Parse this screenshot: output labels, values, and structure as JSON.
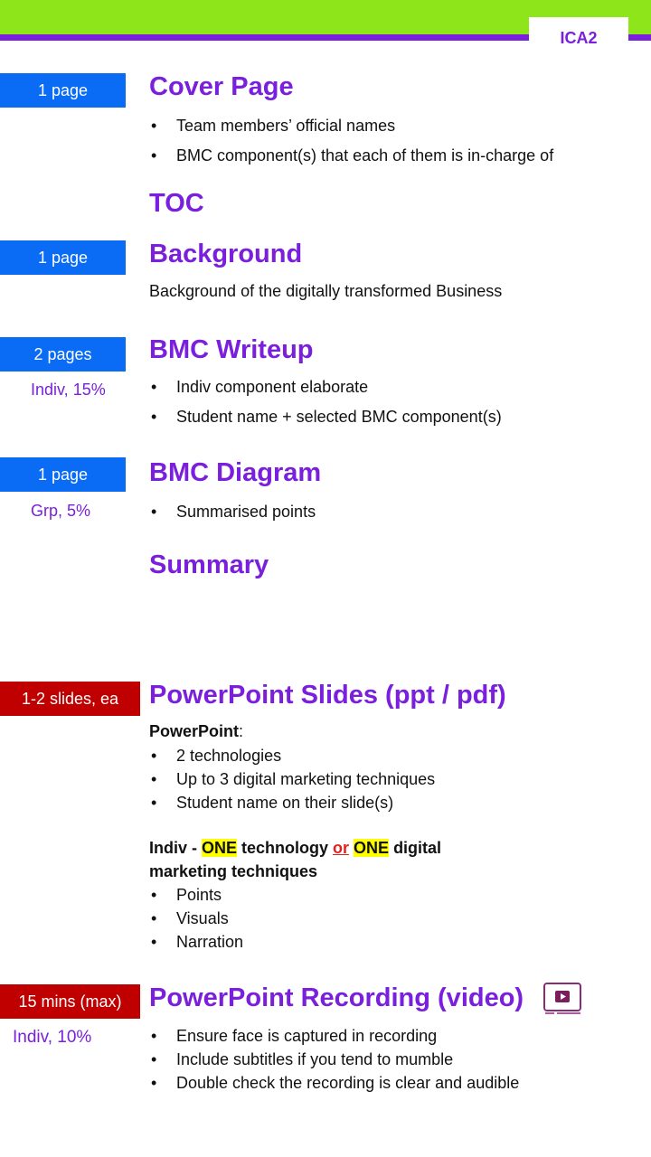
{
  "header": {
    "tag": "ICA2"
  },
  "sections": {
    "cover": {
      "badge": "1 page",
      "title": "Cover Page",
      "bullets": [
        "Team members’ official names",
        "BMC component(s) that each of them is in-charge of"
      ]
    },
    "toc": {
      "title": "TOC"
    },
    "background": {
      "badge": "1 page",
      "title": "Background",
      "text": "Background of the digitally transformed Business"
    },
    "writeup": {
      "badge": "2 pages",
      "sub": "Indiv, 15%",
      "title": "BMC Writeup",
      "bullets": [
        "Indiv component elaborate",
        "Student name + selected BMC component(s)"
      ]
    },
    "diagram": {
      "badge": "1 page",
      "sub": "Grp, 5%",
      "title": "BMC Diagram",
      "bullets": [
        "Summarised points"
      ]
    },
    "summary": {
      "title": "Summary"
    },
    "slides": {
      "badge": "1-2 slides, ea",
      "title": "PowerPoint Slides (ppt / pdf)",
      "label": "PowerPoint",
      "label_colon": ":",
      "bullets": [
        "2 technologies",
        "Up to 3 digital marketing techniques",
        "Student name on their slide(s)"
      ],
      "indiv_line1": {
        "a": "Indiv - ",
        "b": "ONE",
        "c": " technology ",
        "d": "or",
        "e": " ",
        "f": "ONE",
        "g": " digital"
      },
      "indiv_line2": "marketing techniques",
      "indiv_bullets": [
        "Points",
        "Visuals",
        "Narration"
      ]
    },
    "recording": {
      "badge": "15 mins (max)",
      "sub": "Indiv, 10%",
      "title": "PowerPoint Recording (video)",
      "icon": "video-play-icon",
      "bullets": [
        "Ensure face is captured in recording",
        "Include subtitles if you tend to mumble",
        "Double check the recording is clear and audible"
      ]
    }
  },
  "colors": {
    "purple": "#7a1fdc",
    "green": "#8ee61a",
    "blue": "#0a6cf5",
    "red": "#c00000",
    "highlight": "#ffff00"
  }
}
